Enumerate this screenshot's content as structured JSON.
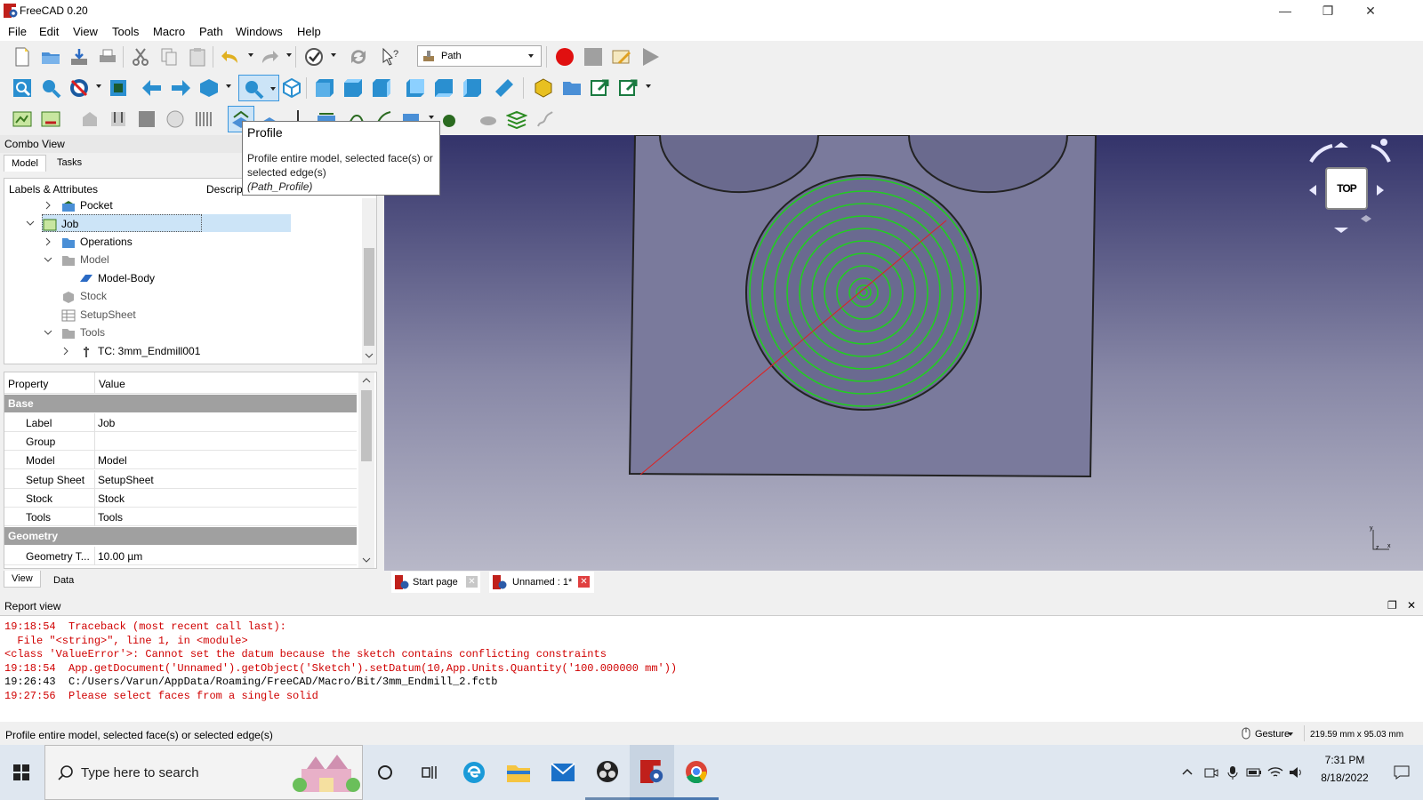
{
  "window": {
    "title": "FreeCAD 0.20",
    "minimize": "—",
    "restore": "❐",
    "close": "✕"
  },
  "menu": [
    "File",
    "Edit",
    "View",
    "Tools",
    "Macro",
    "Path",
    "Windows",
    "Help"
  ],
  "toolbar": {
    "workbench": "Path"
  },
  "tooltip": {
    "title": "Profile",
    "body": "Profile entire model, selected face(s) or selected edge(s)",
    "command": "(Path_Profile)"
  },
  "combo": {
    "title": "Combo View",
    "tabs": [
      "Model",
      "Tasks"
    ],
    "tree_headers": {
      "labels": "Labels & Attributes",
      "description": "Descript"
    },
    "tree": [
      {
        "label": "Pocket"
      },
      {
        "label": "Job"
      },
      {
        "label": "Operations"
      },
      {
        "label": "Model"
      },
      {
        "label": "Model-Body"
      },
      {
        "label": "Stock"
      },
      {
        "label": "SetupSheet"
      },
      {
        "label": "Tools"
      },
      {
        "label": "TC: 3mm_Endmill001"
      }
    ],
    "props_headers": {
      "property": "Property",
      "value": "Value"
    },
    "groups": {
      "base": "Base",
      "geometry": "Geometry"
    },
    "properties": [
      {
        "key": "Label",
        "value": "Job"
      },
      {
        "key": "Group",
        "value": ""
      },
      {
        "key": "Model",
        "value": "Model"
      },
      {
        "key": "Setup Sheet",
        "value": "SetupSheet"
      },
      {
        "key": "Stock",
        "value": "Stock"
      },
      {
        "key": "Tools",
        "value": "Tools"
      }
    ],
    "geometry_property": {
      "key": "Geometry T...",
      "value": "10.00 µm"
    },
    "bottom_tabs": [
      "View",
      "Data"
    ]
  },
  "navcube": {
    "face": "TOP"
  },
  "doc_tabs": [
    "Start page",
    "Unnamed : 1*"
  ],
  "report": {
    "title": "Report view",
    "lines": [
      {
        "text": "19:18:54  Traceback (most recent call last):",
        "color": "#d00000"
      },
      {
        "text": "  File \"<string>\", line 1, in <module>",
        "color": "#d00000"
      },
      {
        "text": "<class 'ValueError'>: Cannot set the datum because the sketch contains conflicting constraints",
        "color": "#d00000"
      },
      {
        "text": "19:18:54  App.getDocument('Unnamed').getObject('Sketch').setDatum(10,App.Units.Quantity('100.000000 mm'))",
        "color": "#d00000"
      },
      {
        "text": "19:26:43  C:/Users/Varun/AppData/Roaming/FreeCAD/Macro/Bit/3mm_Endmill_2.fctb",
        "color": "#000000"
      },
      {
        "text": "19:27:56  Please select faces from a single solid",
        "color": "#d00000"
      }
    ]
  },
  "status": {
    "message": "Profile entire model, selected face(s) or selected edge(s)",
    "nav_style": "Gesture",
    "dimensions": "219.59 mm x 95.03 mm"
  },
  "taskbar": {
    "search_placeholder": "Type here to search",
    "time": "7:31 PM",
    "date": "8/18/2022"
  },
  "colors": {
    "toolpath": "#22cc22",
    "selection": "#cce4f7",
    "error": "#d00000"
  }
}
